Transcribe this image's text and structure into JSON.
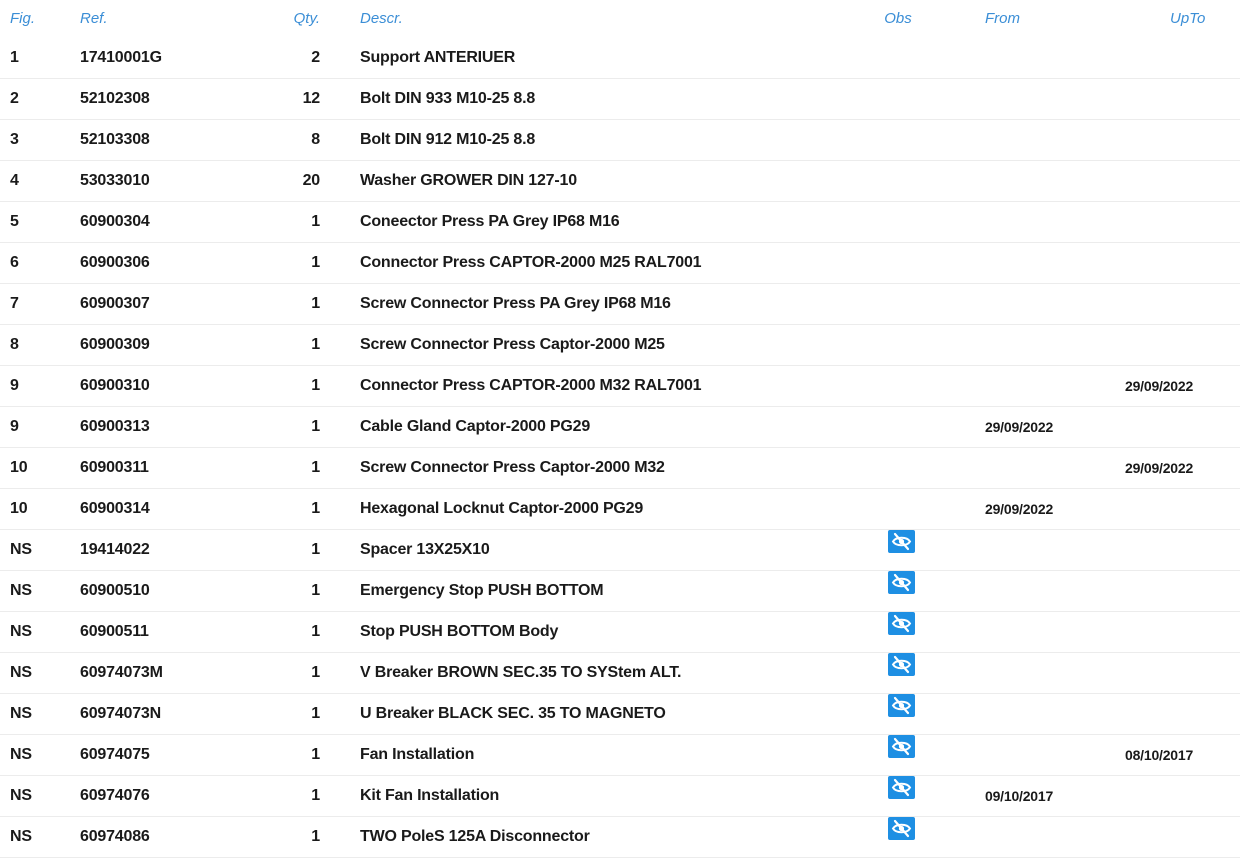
{
  "headers": {
    "fig": "Fig.",
    "ref": "Ref.",
    "qty": "Qty.",
    "descr": "Descr.",
    "obs": "Obs",
    "from": "From",
    "upto": "UpTo"
  },
  "obs_icon": "eye-slash-icon",
  "colors": {
    "header_text": "#3b8ed6",
    "obs_icon_bg": "#1e8fe3",
    "row_divider": "#ececec"
  },
  "rows": [
    {
      "fig": "1",
      "ref": "17410001G",
      "qty": "2",
      "descr": "Support ANTERIUER",
      "obs": false,
      "from": "",
      "upto": ""
    },
    {
      "fig": "2",
      "ref": "52102308",
      "qty": "12",
      "descr": "Bolt DIN 933 M10-25 8.8",
      "obs": false,
      "from": "",
      "upto": ""
    },
    {
      "fig": "3",
      "ref": "52103308",
      "qty": "8",
      "descr": "Bolt DIN 912 M10-25 8.8",
      "obs": false,
      "from": "",
      "upto": ""
    },
    {
      "fig": "4",
      "ref": "53033010",
      "qty": "20",
      "descr": "Washer GROWER DIN 127-10",
      "obs": false,
      "from": "",
      "upto": ""
    },
    {
      "fig": "5",
      "ref": "60900304",
      "qty": "1",
      "descr": "Coneector Press PA Grey IP68 M16",
      "obs": false,
      "from": "",
      "upto": ""
    },
    {
      "fig": "6",
      "ref": "60900306",
      "qty": "1",
      "descr": "Connector Press CAPTOR-2000 M25 RAL7001",
      "obs": false,
      "from": "",
      "upto": ""
    },
    {
      "fig": "7",
      "ref": "60900307",
      "qty": "1",
      "descr": "Screw Connector Press PA Grey IP68 M16",
      "obs": false,
      "from": "",
      "upto": ""
    },
    {
      "fig": "8",
      "ref": "60900309",
      "qty": "1",
      "descr": "Screw Connector Press Captor-2000 M25",
      "obs": false,
      "from": "",
      "upto": ""
    },
    {
      "fig": "9",
      "ref": "60900310",
      "qty": "1",
      "descr": "Connector Press CAPTOR-2000 M32 RAL7001",
      "obs": false,
      "from": "",
      "upto": "29/09/2022"
    },
    {
      "fig": "9",
      "ref": "60900313",
      "qty": "1",
      "descr": "Cable Gland Captor-2000 PG29",
      "obs": false,
      "from": "29/09/2022",
      "upto": ""
    },
    {
      "fig": "10",
      "ref": "60900311",
      "qty": "1",
      "descr": "Screw Connector Press Captor-2000 M32",
      "obs": false,
      "from": "",
      "upto": "29/09/2022"
    },
    {
      "fig": "10",
      "ref": "60900314",
      "qty": "1",
      "descr": "Hexagonal Locknut Captor-2000 PG29",
      "obs": false,
      "from": "29/09/2022",
      "upto": ""
    },
    {
      "fig": "NS",
      "ref": "19414022",
      "qty": "1",
      "descr": "Spacer 13X25X10",
      "obs": true,
      "from": "",
      "upto": ""
    },
    {
      "fig": "NS",
      "ref": "60900510",
      "qty": "1",
      "descr": "Emergency Stop PUSH BOTTOM",
      "obs": true,
      "from": "",
      "upto": ""
    },
    {
      "fig": "NS",
      "ref": "60900511",
      "qty": "1",
      "descr": "Stop PUSH BOTTOM Body",
      "obs": true,
      "from": "",
      "upto": ""
    },
    {
      "fig": "NS",
      "ref": "60974073M",
      "qty": "1",
      "descr": "V Breaker BROWN SEC.35 TO SYStem ALT.",
      "obs": true,
      "from": "",
      "upto": ""
    },
    {
      "fig": "NS",
      "ref": "60974073N",
      "qty": "1",
      "descr": "U Breaker BLACK SEC. 35 TO MAGNETO",
      "obs": true,
      "from": "",
      "upto": ""
    },
    {
      "fig": "NS",
      "ref": "60974075",
      "qty": "1",
      "descr": "Fan Installation",
      "obs": true,
      "from": "",
      "upto": "08/10/2017"
    },
    {
      "fig": "NS",
      "ref": "60974076",
      "qty": "1",
      "descr": "Kit Fan Installation",
      "obs": true,
      "from": "09/10/2017",
      "upto": ""
    },
    {
      "fig": "NS",
      "ref": "60974086",
      "qty": "1",
      "descr": "TWO PoleS 125A Disconnector",
      "obs": true,
      "from": "",
      "upto": ""
    }
  ]
}
